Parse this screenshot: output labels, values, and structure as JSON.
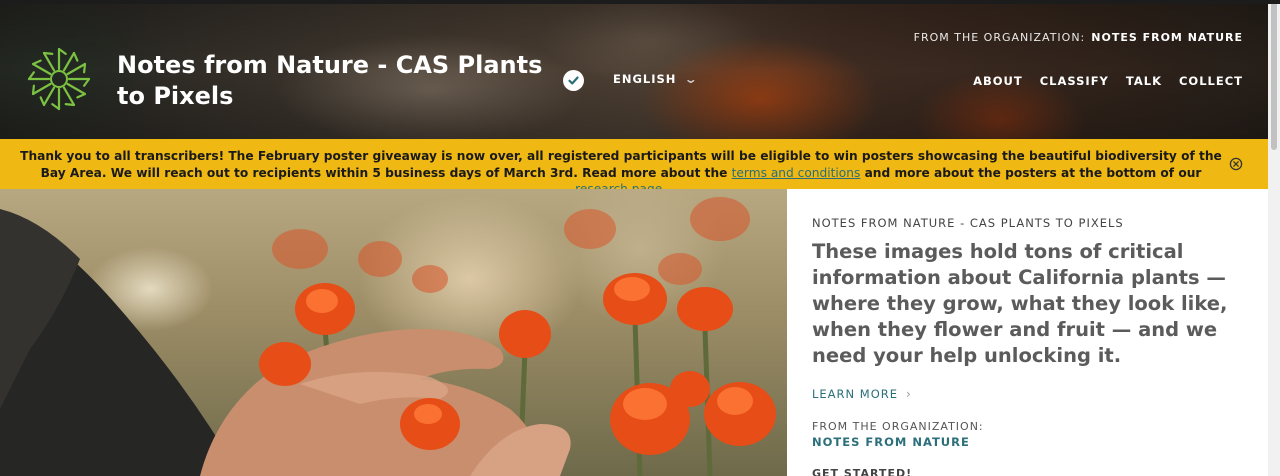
{
  "header": {
    "project_title": "Notes from Nature - CAS Plants to Pixels",
    "language": "ENGLISH",
    "org_prefix": "FROM THE ORGANIZATION:",
    "org_name": "NOTES FROM NATURE",
    "nav": [
      "ABOUT",
      "CLASSIFY",
      "TALK",
      "COLLECT"
    ],
    "icons": {
      "logo": "starburst-logo",
      "verified": "check-badge-icon",
      "language_toggle": "chevron-down-icon"
    }
  },
  "banner": {
    "text_before": "Thank you to all transcribers! The February poster giveaway is now over, all registered participants will be eligible to win posters showcasing the beautiful biodiversity of the Bay Area. We will reach out to recipients within 5 business days of March 3rd. Read more about the ",
    "link1": "terms and conditions",
    "text_middle": " and more about the posters at the bottom of our ",
    "link2": "research page",
    "text_after": ".",
    "close_icon": "close-circle-icon",
    "bg_color": "#efb813"
  },
  "hero": {
    "image": "hands-and-orange-paintbrush-flowers-photo"
  },
  "panel": {
    "eyebrow": "NOTES FROM NATURE - CAS PLANTS TO PIXELS",
    "description": "These images hold tons of critical information about California plants — where they grow, what they look like, when they flower and fruit — and we need your help unlocking it.",
    "learn_more": "LEARN MORE",
    "from_org_label": "FROM THE ORGANIZATION:",
    "from_org_name": "NOTES FROM NATURE",
    "get_started": "GET STARTED!"
  },
  "colors": {
    "accent_teal": "#2b6f7a",
    "logo_green": "#7cc242"
  }
}
